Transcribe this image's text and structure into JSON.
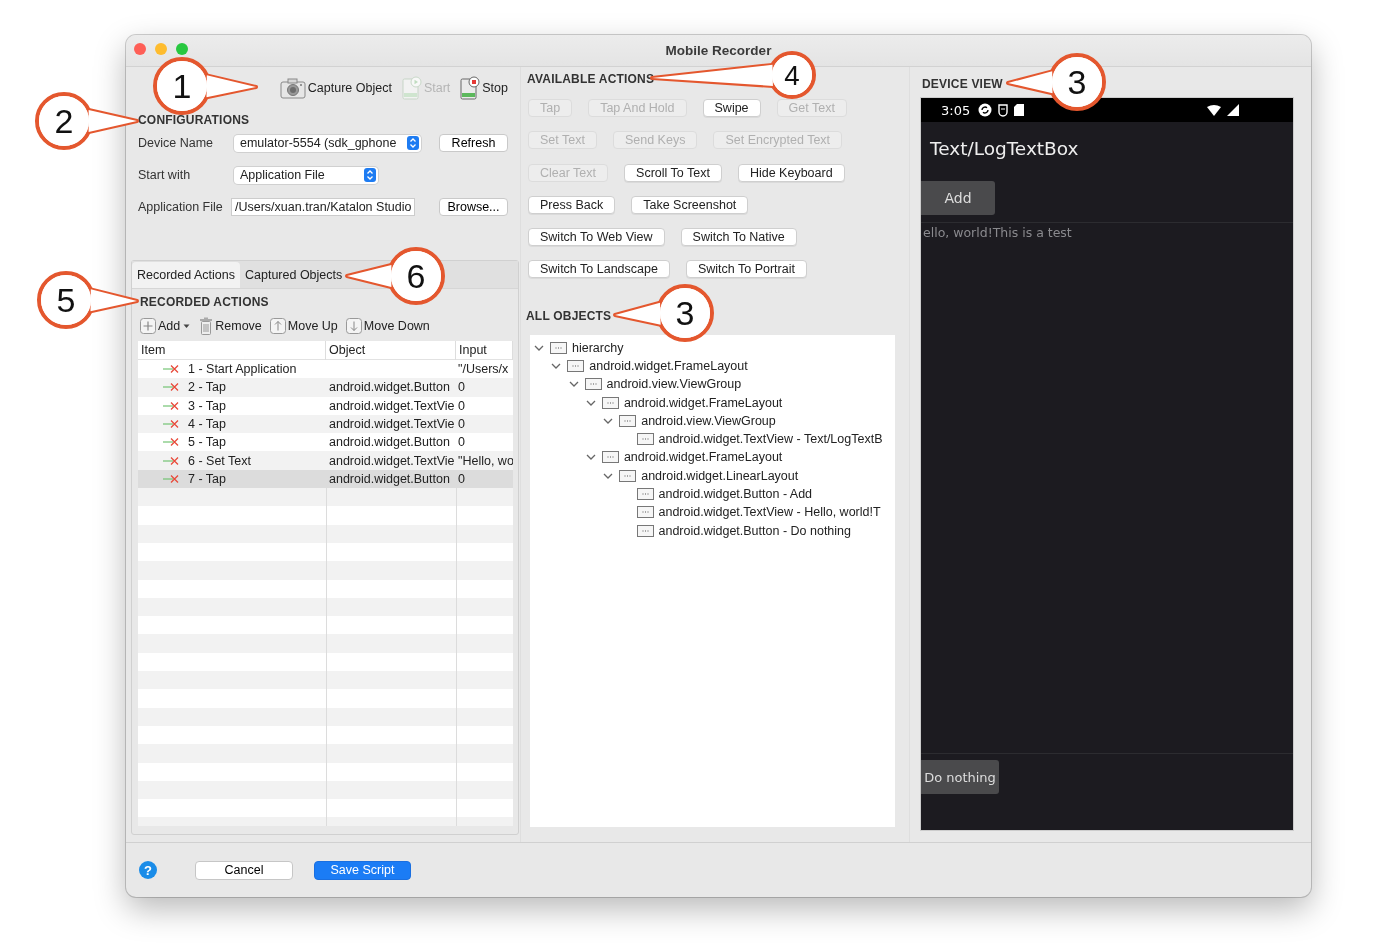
{
  "window": {
    "title": "Mobile Recorder"
  },
  "toolbar": [
    {
      "label": "Capture Object",
      "kind": "capture",
      "disabled": false
    },
    {
      "label": "Start",
      "kind": "start",
      "disabled": true
    },
    {
      "label": "Stop",
      "kind": "stop",
      "disabled": false
    }
  ],
  "configurations": {
    "heading": "CONFIGURATIONS",
    "fields": [
      {
        "label": "Device Name",
        "kind": "select",
        "value": "emulator-5554 (sdk_gphone",
        "button": "Refresh"
      },
      {
        "label": "Start with",
        "kind": "select",
        "value": "Application File"
      },
      {
        "label": "Application File",
        "kind": "text",
        "value": "/Users/xuan.tran/Katalon Studio",
        "button": "Browse..."
      }
    ]
  },
  "tabs": [
    {
      "label": "Recorded Actions",
      "selected": true
    },
    {
      "label": "Captured Objects",
      "selected": false
    }
  ],
  "recorded_actions": {
    "heading": "RECORDED ACTIONS",
    "tools": [
      {
        "label": "Add",
        "kind": "add"
      },
      {
        "label": "Remove",
        "kind": "remove"
      },
      {
        "label": "Move Up",
        "kind": "up"
      },
      {
        "label": "Move Down",
        "kind": "down"
      }
    ],
    "columns": [
      "Item",
      "Object",
      "Input"
    ],
    "rows": [
      {
        "item": "1 - Start Application",
        "input": "\"/Users/x",
        "selected": false
      },
      {
        "item": "2 - Tap",
        "object": "android.widget.Button",
        "input": "0",
        "selected": false
      },
      {
        "item": "3 - Tap",
        "object": "android.widget.TextVie",
        "input": "0",
        "selected": false
      },
      {
        "item": "4 - Tap",
        "object": "android.widget.TextVie",
        "input": "0",
        "selected": false
      },
      {
        "item": "5 - Tap",
        "object": "android.widget.Button",
        "input": "0",
        "selected": false
      },
      {
        "item": "6 - Set Text",
        "object": "android.widget.TextVie",
        "input": "\"Hello, wo",
        "selected": false
      },
      {
        "item": "7 - Tap",
        "object": "android.widget.Button",
        "input": "0",
        "selected": true
      }
    ]
  },
  "available_actions": {
    "heading": "AVAILABLE ACTIONS",
    "rows": [
      [
        {
          "label": "Tap",
          "disabled": true
        },
        {
          "label": "Tap And Hold",
          "disabled": true
        },
        {
          "label": "Swipe",
          "disabled": false
        },
        {
          "label": "Get Text",
          "disabled": true
        }
      ],
      [
        {
          "label": "Set Text",
          "disabled": true
        },
        {
          "label": "Send Keys",
          "disabled": true
        },
        {
          "label": "Set Encrypted Text",
          "disabled": true
        }
      ],
      [
        {
          "label": "Clear Text",
          "disabled": true
        },
        {
          "label": "Scroll To Text",
          "disabled": false
        },
        {
          "label": "Hide Keyboard",
          "disabled": false
        }
      ],
      [
        {
          "label": "Press Back",
          "disabled": false
        },
        {
          "label": "Take Screenshot",
          "disabled": false
        }
      ],
      [
        {
          "label": "Switch To Web View",
          "disabled": false
        },
        {
          "label": "Switch To Native",
          "disabled": false
        }
      ],
      [
        {
          "label": "Switch To Landscape",
          "disabled": false
        },
        {
          "label": "Switch To Portrait",
          "disabled": false
        }
      ]
    ]
  },
  "all_objects": {
    "heading": "ALL OBJECTS",
    "tree": [
      {
        "label": "hierarchy",
        "expanded": true,
        "children": [
          {
            "label": "android.widget.FrameLayout",
            "expanded": true,
            "children": [
              {
                "label": "android.view.ViewGroup",
                "expanded": true,
                "children": [
                  {
                    "label": "android.widget.FrameLayout",
                    "expanded": true,
                    "children": [
                      {
                        "label": "android.view.ViewGroup",
                        "expanded": true,
                        "children": [
                          {
                            "label": "android.widget.TextView - Text/LogTextB"
                          }
                        ]
                      }
                    ]
                  },
                  {
                    "label": "android.widget.FrameLayout",
                    "expanded": true,
                    "children": [
                      {
                        "label": "android.widget.LinearLayout",
                        "expanded": true,
                        "children": [
                          {
                            "label": "android.widget.Button - Add"
                          },
                          {
                            "label": "android.widget.TextView - Hello, world!T"
                          },
                          {
                            "label": "android.widget.Button - Do nothing"
                          }
                        ]
                      }
                    ]
                  }
                ]
              }
            ]
          }
        ]
      }
    ]
  },
  "device_view": {
    "heading": "DEVICE VIEW",
    "time": "3:05",
    "app_title": "Text/LogTextBox",
    "add_button": "Add",
    "log_text": "ello, world!This is a test",
    "bottom_button": "Do nothing"
  },
  "footer": {
    "help": "?",
    "buttons": [
      {
        "label": "Cancel",
        "kind": "default"
      },
      {
        "label": "Save Script",
        "kind": "primary"
      }
    ]
  },
  "callouts": [
    {
      "number": "1"
    },
    {
      "number": "4"
    },
    {
      "number": "3"
    },
    {
      "number": "2"
    },
    {
      "number": "6"
    },
    {
      "number": "5"
    },
    {
      "number": "3"
    }
  ]
}
